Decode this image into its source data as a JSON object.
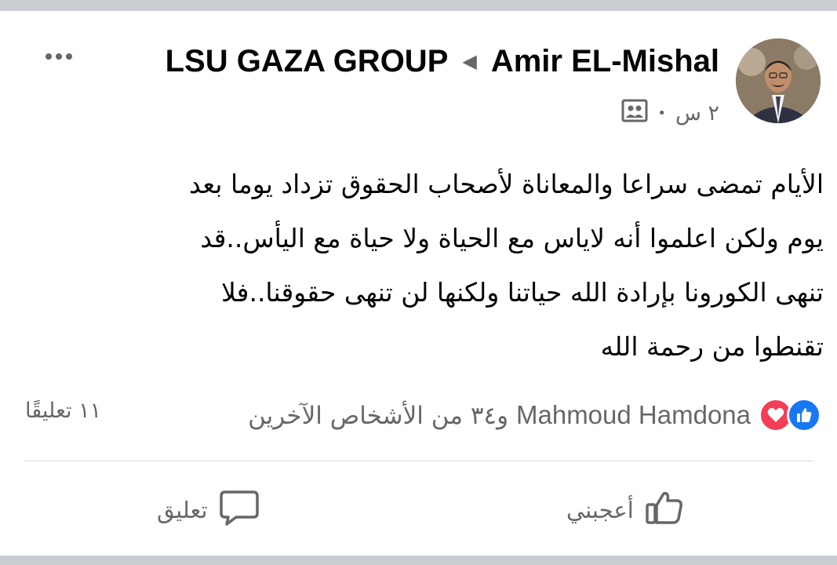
{
  "post": {
    "group_name": "LSU GAZA GROUP",
    "author_name": "Amir EL-Mishal",
    "timestamp": "٢ س",
    "audience_icon": "group-members-icon",
    "text_lines": [
      "الأيام تمضى سراعا والمعاناة لأصحاب الحقوق تزداد يوما بعد",
      "يوم ولكن اعلموا أنه لاياس مع الحياة ولا حياة مع اليأس..قد",
      "تنهى الكورونا بإرادة الله حياتنا ولكنها لن تنهى حقوقنا..فلا",
      "تقنطوا من رحمة الله"
    ]
  },
  "reactions": {
    "icons": [
      "like-icon",
      "love-icon"
    ],
    "lead_name": "Mahmoud Hamdona",
    "others_text": "و٣٤ من الأشخاص الآخرين"
  },
  "comments_count": "١١ تعليقًا",
  "actions": {
    "like_label": "أعجبني",
    "comment_label": "تعليق"
  },
  "colors": {
    "like_blue": "#1877f2",
    "love_red": "#f33e58",
    "secondary_text": "#65676b",
    "separator": "#c9ccd1"
  }
}
